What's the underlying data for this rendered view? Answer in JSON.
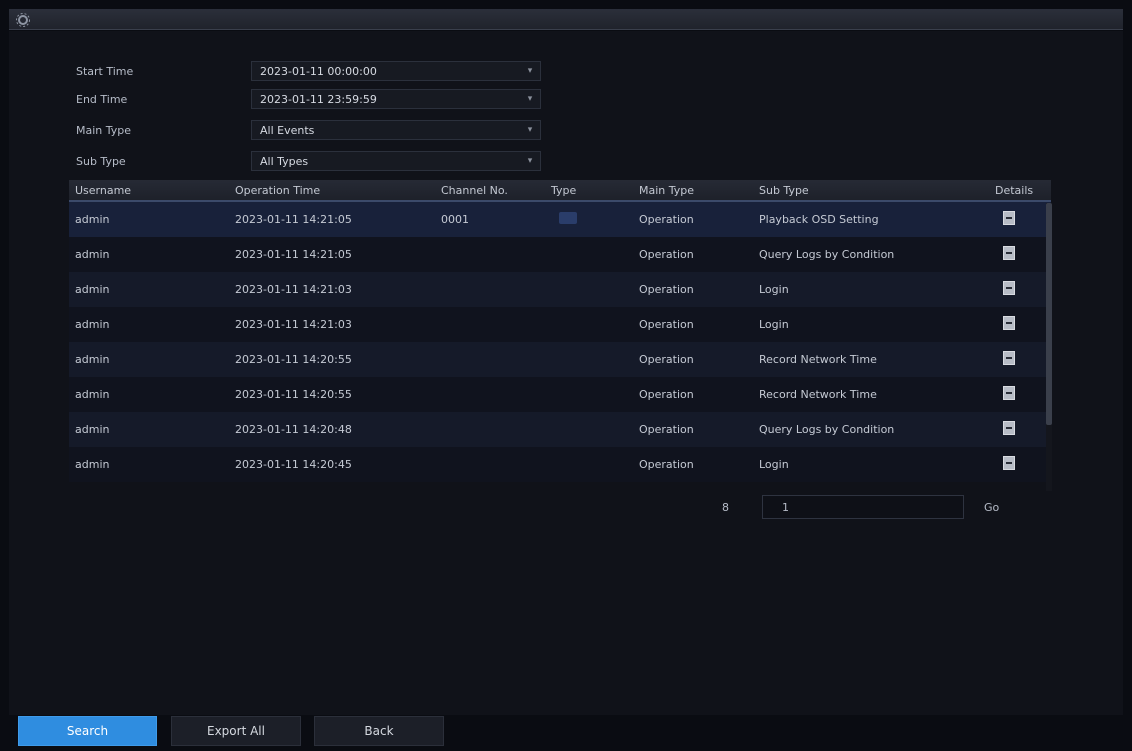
{
  "window": {
    "logo_icon": "gear-icon"
  },
  "filters": [
    {
      "label": "Start Time",
      "value": "2023-01-11 00:00:00"
    },
    {
      "label": "End Time",
      "value": "2023-01-11 23:59:59"
    },
    {
      "label": "Main Type",
      "value": "All Events"
    },
    {
      "label": "Sub Type",
      "value": "All Types"
    }
  ],
  "table": {
    "headers": [
      "Username",
      "Operation Time",
      "Channel No.",
      "Type",
      "Main Type",
      "Sub Type",
      "Details"
    ],
    "rows": [
      {
        "user": "admin",
        "time": "2023-01-11 14:21:05",
        "channel": "0001",
        "main": "Operation",
        "sub": "Playback OSD Setting"
      },
      {
        "user": "admin",
        "time": "2023-01-11 14:21:05",
        "channel": "",
        "main": "Operation",
        "sub": "Query Logs by Condition"
      },
      {
        "user": "admin",
        "time": "2023-01-11 14:21:03",
        "channel": "",
        "main": "Operation",
        "sub": "Login"
      },
      {
        "user": "admin",
        "time": "2023-01-11 14:21:03",
        "channel": "",
        "main": "Operation",
        "sub": "Login"
      },
      {
        "user": "admin",
        "time": "2023-01-11 14:20:55",
        "channel": "",
        "main": "Operation",
        "sub": "Record Network Time"
      },
      {
        "user": "admin",
        "time": "2023-01-11 14:20:55",
        "channel": "",
        "main": "Operation",
        "sub": "Record Network Time"
      },
      {
        "user": "admin",
        "time": "2023-01-11 14:20:48",
        "channel": "",
        "main": "Operation",
        "sub": "Query Logs by Condition"
      },
      {
        "user": "admin",
        "time": "2023-01-11 14:20:45",
        "channel": "",
        "main": "Operation",
        "sub": "Login"
      }
    ]
  },
  "pager": {
    "total_label": "8",
    "page_label": "1",
    "go_label": "Go"
  },
  "footer": {
    "search_label": "Search",
    "export_label": "Export All",
    "back_label": "Back"
  }
}
